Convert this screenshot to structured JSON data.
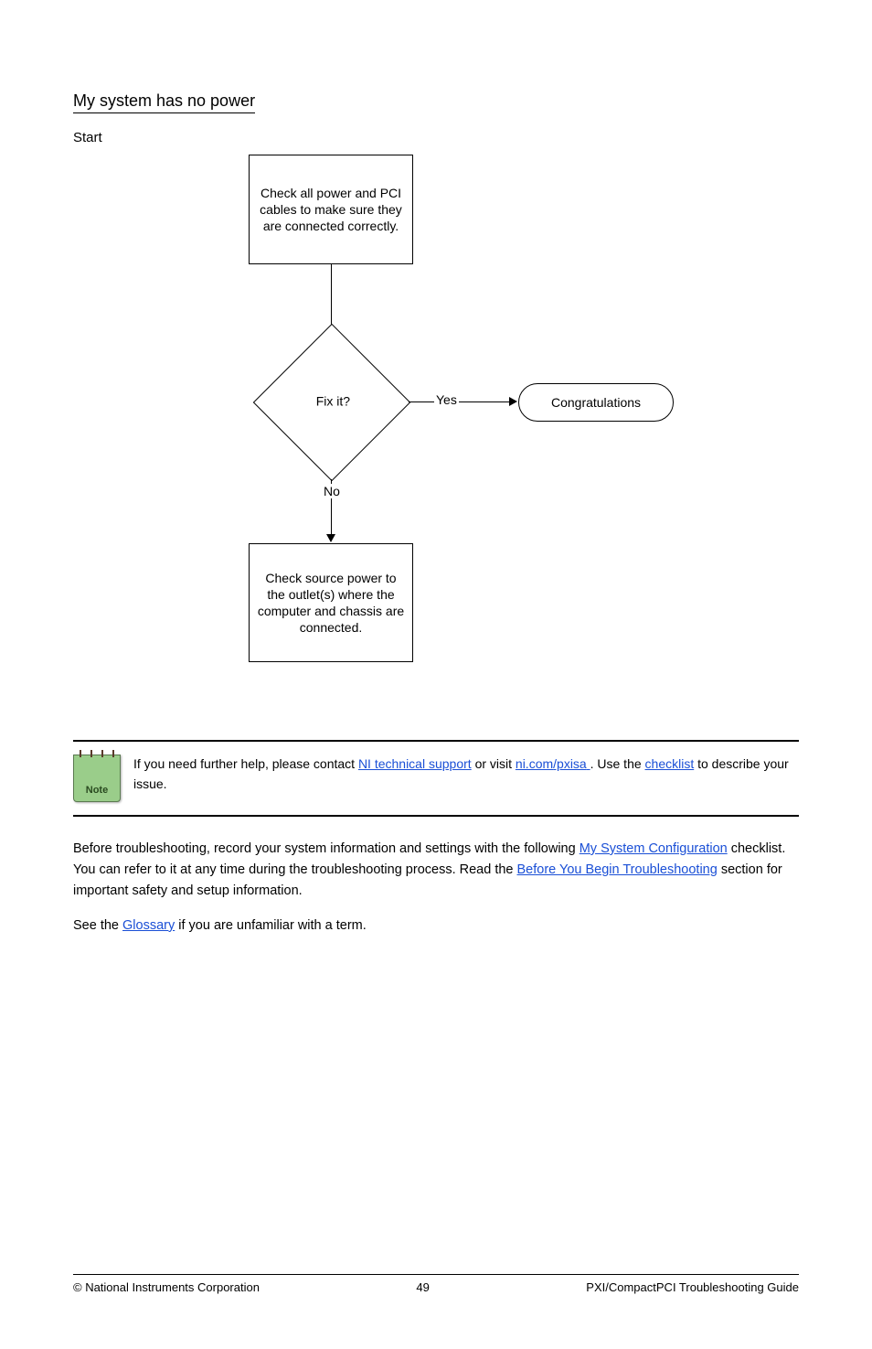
{
  "section": {
    "title": "My system has no power",
    "subtitle": "Start"
  },
  "flowchart": {
    "step1": "Check all power and PCI cables to make sure they are connected correctly.",
    "decision": "Fix it?",
    "yes": "Yes",
    "no": "No",
    "congrats": "Congratulations",
    "step2": "Check source power to the outlet(s) where the computer and chassis are connected."
  },
  "note": {
    "icon_label": "Note",
    "text_before": "If you need further help, please contact ",
    "link1_text": "NI technical support",
    "text_mid": " or visit ",
    "link2_mid": "ni.com",
    "link2_rest": "/pxisa",
    "text_end": ". Use the ",
    "link3_text": "checklist",
    "text_after_link3": " to describe your issue."
  },
  "instructions": {
    "para1_a": "Before troubleshooting, record your system information and settings with the following ",
    "para1_link": "My System Configuration",
    "para1_b": " checklist. You can refer to it at any time during the troubleshooting process. Read the ",
    "para1_link2": "Before You Begin Troubleshooting",
    "para1_c": " section for important safety and setup information.",
    "para2_a": "See the ",
    "para2_link": "Glossary",
    "para2_b": " if you are unfamiliar with a term."
  },
  "footer": {
    "left": "© National Instruments Corporation",
    "center": "49",
    "right": "PXI/CompactPCI Troubleshooting Guide"
  }
}
